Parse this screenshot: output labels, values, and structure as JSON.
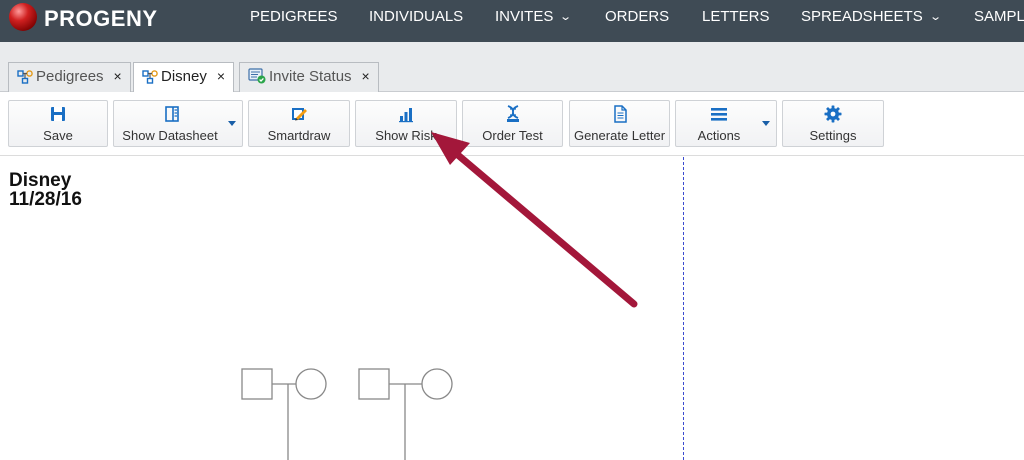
{
  "app": {
    "brand": "PROGENY",
    "nav": [
      {
        "label": "PEDIGREES",
        "dropdown": false
      },
      {
        "label": "INDIVIDUALS",
        "dropdown": false
      },
      {
        "label": "INVITES",
        "dropdown": true
      },
      {
        "label": "ORDERS",
        "dropdown": false
      },
      {
        "label": "LETTERS",
        "dropdown": false
      },
      {
        "label": "SPREADSHEETS",
        "dropdown": true
      },
      {
        "label": "SAMPL",
        "dropdown": false
      }
    ]
  },
  "tabs": [
    {
      "label": "Pedigrees",
      "close": "×",
      "active": false,
      "icon": "pedigree-icon"
    },
    {
      "label": "Disney",
      "close": "×",
      "active": true,
      "icon": "pedigree-icon"
    },
    {
      "label": "Invite Status",
      "close": "×",
      "active": false,
      "icon": "invite-status-icon"
    }
  ],
  "toolbar": {
    "save": "Save",
    "show_datasheet": "Show Datasheet",
    "smartdraw": "Smartdraw",
    "show_risk": "Show Risk",
    "order_test": "Order Test",
    "generate_letter": "Generate Letter",
    "actions": "Actions",
    "settings": "Settings"
  },
  "pedigree": {
    "name": "Disney",
    "date": "11/28/16"
  },
  "colors": {
    "nav_bg": "#3f4b55",
    "icon_blue": "#1a6fc4",
    "annotation_arrow": "#a3173a",
    "page_divider": "#3b4bd0"
  }
}
